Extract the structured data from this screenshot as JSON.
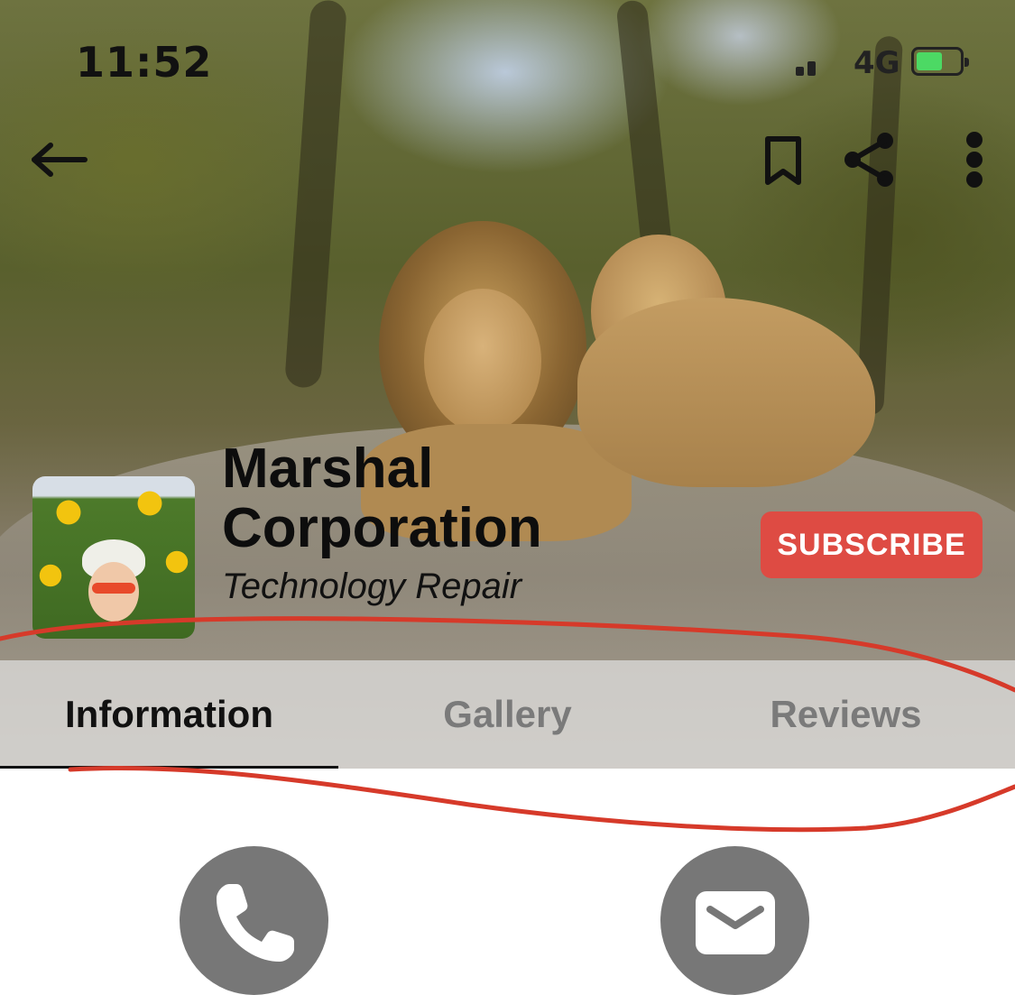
{
  "status_bar": {
    "time": "11:52",
    "network": "4G",
    "battery_color": "#4cd964"
  },
  "toolbar": {
    "back_icon": "arrow-left-icon",
    "bookmark_icon": "bookmark-icon",
    "share_icon": "share-icon",
    "more_icon": "more-vertical-icon"
  },
  "profile": {
    "name_line1": "Marshal",
    "name_line2": "Corporation",
    "category": "Technology Repair",
    "subscribe_label": "SUBSCRIBE",
    "subscribe_color": "#de4b43"
  },
  "tabs": [
    {
      "label": "Information",
      "active": true
    },
    {
      "label": "Gallery",
      "active": false
    },
    {
      "label": "Reviews",
      "active": false
    }
  ],
  "actions": {
    "phone_icon": "phone-icon",
    "email_icon": "mail-icon"
  },
  "annotation_color": "#d63a2a"
}
